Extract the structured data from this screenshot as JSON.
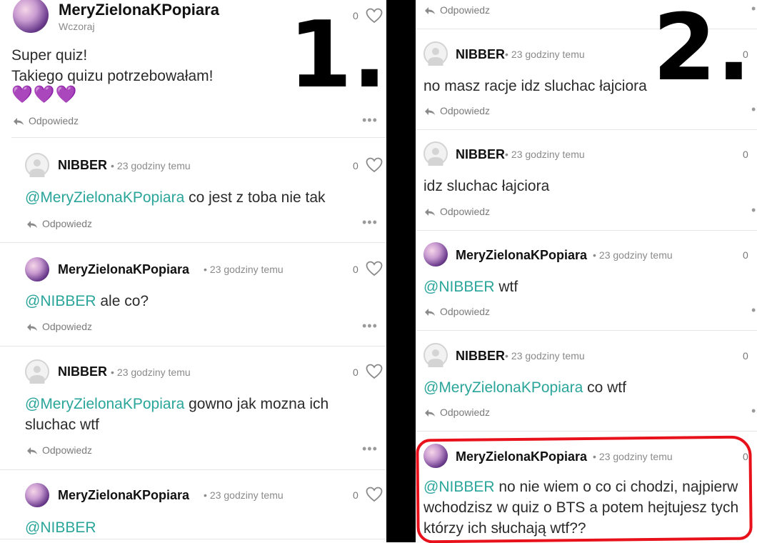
{
  "left": {
    "label": "1.",
    "top_comment": {
      "author": "MeryZielonaKPopiara",
      "time": "Wczoraj",
      "likes": "0",
      "lines": [
        "Super quiz!",
        "Takiego quizu potrzebowałam!"
      ],
      "emoji": "💜💜💜",
      "reply_label": "Odpowiedz"
    },
    "replies": [
      {
        "author": "NIBBER",
        "time": "23 godziny temu",
        "likes": "0",
        "mention": "@MeryZielonaKPopiara",
        "text": " co jest z toba nie tak",
        "reply_label": "Odpowiedz"
      },
      {
        "author": "MeryZielonaKPopiara",
        "time": "23 godziny temu",
        "likes": "0",
        "mention": "@NIBBER",
        "text": " ale co?",
        "reply_label": "Odpowiedz"
      },
      {
        "author": "NIBBER",
        "time": "23 godziny temu",
        "likes": "0",
        "mention": "@MeryZielonaKPopiara",
        "text": " gowno jak mozna ich",
        "text2": "sluchac wtf",
        "reply_label": "Odpowiedz"
      },
      {
        "author": "MeryZielonaKPopiara",
        "time": "23 godziny temu",
        "likes": "0",
        "mention": "@NIBBER",
        "text": ""
      }
    ]
  },
  "right": {
    "label": "2.",
    "top_reply_label": "Odpowiedz",
    "comments": [
      {
        "author": "NIBBER",
        "time": "23 godziny temu",
        "likes": "0",
        "mention": "",
        "text": "no masz racje idz sluchac łajciora",
        "reply_label": "Odpowiedz"
      },
      {
        "author": "NIBBER",
        "time": "23 godziny temu",
        "likes": "0",
        "mention": "",
        "text": "idz sluchac łajciora",
        "reply_label": "Odpowiedz"
      },
      {
        "author": "MeryZielonaKPopiara",
        "time": "23 godziny temu",
        "likes": "0",
        "mention": "@NIBBER",
        "text": " wtf",
        "reply_label": "Odpowiedz"
      },
      {
        "author": "NIBBER",
        "time": "23 godziny temu",
        "likes": "0",
        "mention": "@MeryZielonaKPopiara",
        "text": " co wtf",
        "reply_label": "Odpowiedz"
      },
      {
        "author": "MeryZielonaKPopiara",
        "time": "23 godziny temu",
        "likes": "0",
        "mention": "@NIBBER",
        "text": " no nie wiem o co ci chodzi, najpierw",
        "text2": "wchodzisz w quiz o BTS a potem hejtujesz tych",
        "text3": "którzy ich słuchają wtf??"
      }
    ]
  },
  "colors": {
    "mention": "#2aa59a",
    "highlight": "#e8101a",
    "divider": "#000000",
    "emoji": "#7b2fbe"
  }
}
